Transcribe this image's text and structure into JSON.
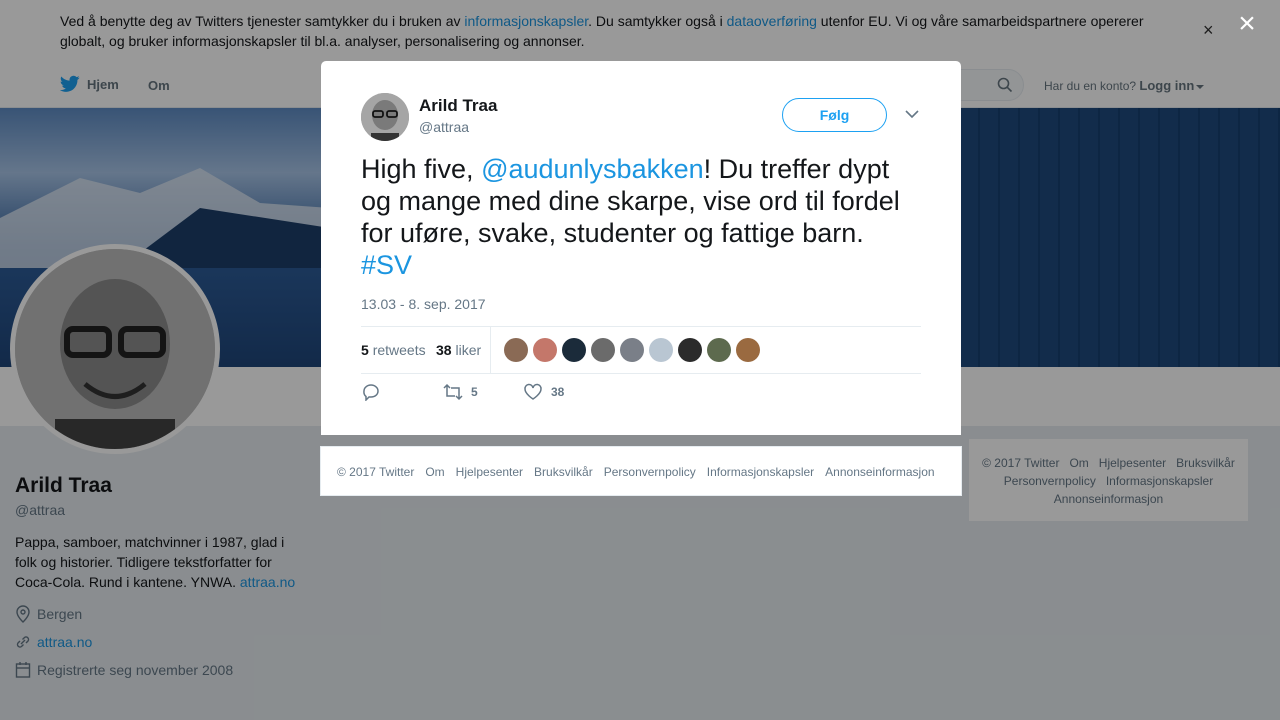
{
  "cookie": {
    "part1": "Ved å benytte deg av Twitters tjenester samtykker du i bruken av ",
    "link1": "informasjonskapsler",
    "part2": ". Du samtykker også i ",
    "link2": "dataoverføring",
    "part3": " utenfor EU. Vi og våre samarbeidspartnere opererer globalt, og bruker informasjonskapsler til bl.a. analyser, personalisering og annonser.",
    "close": "×"
  },
  "nav": {
    "home": "Hjem",
    "about": "Om",
    "login_prompt": "Har du en konto?",
    "login": "Logg inn"
  },
  "profile": {
    "name": "Arild Traa",
    "handle": "@attraa",
    "bio": "Pappa, samboer, matchvinner i 1987, glad i folk og historier. Tidligere tekstforfatter for Coca-Cola. Rund i kantene. YNWA. ",
    "bio_link": "attraa.no",
    "location": "Bergen",
    "website": "attraa.no",
    "joined": "Registrerte seg november 2008"
  },
  "side_footer": {
    "links": [
      "© 2017 Twitter",
      "Om",
      "Hjelpesenter",
      "Bruksvilkår",
      "Personvernpolicy",
      "Informasjonskapsler",
      "Annonseinformasjon"
    ]
  },
  "overlay": {
    "close": "×"
  },
  "tweet": {
    "name": "Arild Traa",
    "handle": "@attraa",
    "follow": "Følg",
    "text_before": "High five, ",
    "mention": "@audunlysbakken",
    "text_after": "! Du treffer dypt og mange med dine skarpe, vise ord til fordel for uføre, svake, studenter og fattige barn. ",
    "hashtag": "#SV",
    "time": "13.03 - 8. sep. 2017",
    "retweets_count": "5",
    "retweets_label": "retweets",
    "likes_count": "38",
    "likes_label": "liker",
    "action_retweets": "5",
    "action_likes": "38",
    "face_colors": [
      "#8a6a55",
      "#c4776a",
      "#1b2b3a",
      "#6b6b6b",
      "#7a7f88",
      "#b9c6d2",
      "#2b2b2b",
      "#5d6a4e",
      "#9a6a40"
    ]
  },
  "modal_footer": {
    "links": [
      "© 2017 Twitter",
      "Om",
      "Hjelpesenter",
      "Bruksvilkår",
      "Personvernpolicy",
      "Informasjonskapsler",
      "Annonseinformasjon"
    ]
  }
}
